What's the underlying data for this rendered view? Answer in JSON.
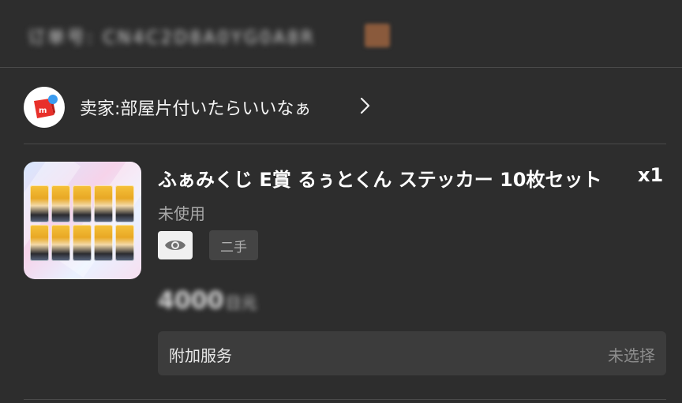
{
  "order": {
    "id_text": "订单号: CN4C2D8A0YG0A8R",
    "copy_icon": "copy-icon"
  },
  "seller": {
    "logo": "mercari-logo",
    "name": "卖家:部屋片付いたらいいなぁ",
    "chevron": "chevron-right-icon"
  },
  "product": {
    "thumbnail": "sticker-product-thumbnail",
    "title": "ふぁみくじ E賞 るぅとくん ステッカー 10枚セット",
    "quantity": "x1",
    "condition": "未使用",
    "preview_icon": "eye-icon",
    "tag": "二手",
    "price": "4000",
    "price_unit": "日元"
  },
  "addon": {
    "label": "附加服务",
    "value": "未选择"
  },
  "colors": {
    "background": "#2d2d2d",
    "text_primary": "#ffffff",
    "text_secondary": "#a8a8a8",
    "mercari_red": "#e8302a",
    "mercari_blue": "#3b9cf0"
  }
}
